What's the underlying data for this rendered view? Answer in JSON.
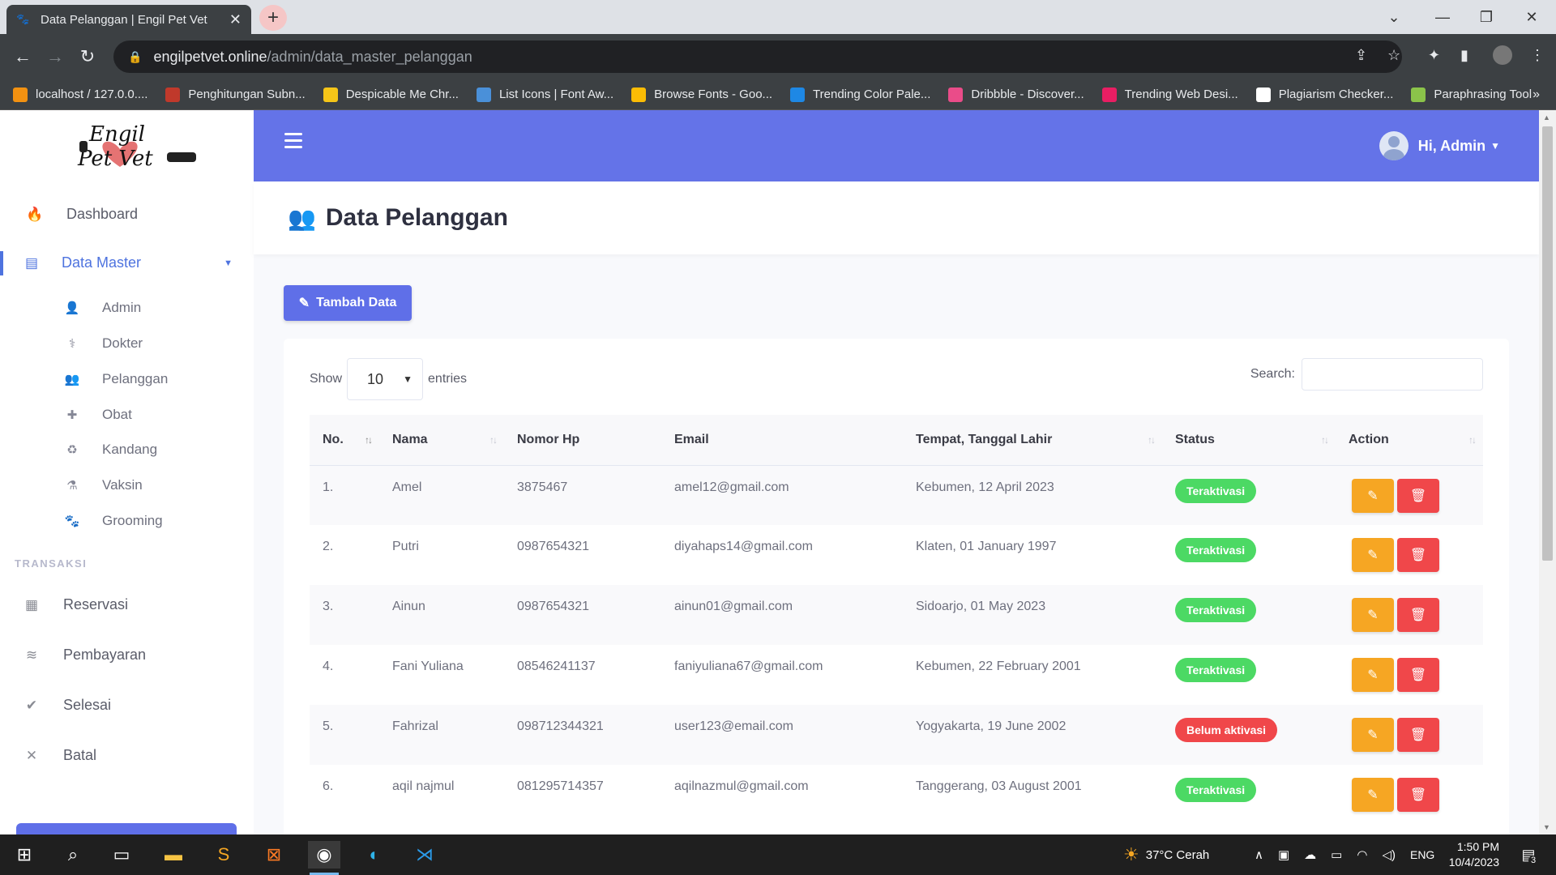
{
  "browser": {
    "tab_title": "Data Pelanggan | Engil Pet Vet",
    "url_host": "engilpetvet.online",
    "url_path": "/admin/data_master_pelanggan",
    "bookmarks": [
      {
        "label": "localhost / 127.0.0....",
        "color": "#f29111"
      },
      {
        "label": "Penghitungan Subn...",
        "color": "#c0392b"
      },
      {
        "label": "Despicable Me Chr...",
        "color": "#f5c518"
      },
      {
        "label": "List Icons | Font Aw...",
        "color": "#4a90d9"
      },
      {
        "label": "Browse Fonts - Goo...",
        "color": "#fbbc05"
      },
      {
        "label": "Trending Color Pale...",
        "color": "#1e88e5"
      },
      {
        "label": "Dribbble - Discover...",
        "color": "#ea4c89"
      },
      {
        "label": "Trending Web Desi...",
        "color": "#e91e63"
      },
      {
        "label": "Plagiarism Checker...",
        "color": "#ffffff"
      },
      {
        "label": "Paraphrasing Tool",
        "color": "#8bc34a"
      }
    ]
  },
  "sidebar": {
    "logo_line1": "Engil",
    "logo_line2": "Pet Vet",
    "dashboard": "Dashboard",
    "data_master": "Data Master",
    "sub_items": [
      {
        "label": "Admin",
        "icon": "user-icon",
        "glyph": "👤"
      },
      {
        "label": "Dokter",
        "icon": "user-md-icon",
        "glyph": "⚕"
      },
      {
        "label": "Pelanggan",
        "icon": "users-icon",
        "glyph": "👥"
      },
      {
        "label": "Obat",
        "icon": "first-aid-icon",
        "glyph": "✚"
      },
      {
        "label": "Kandang",
        "icon": "recycle-icon",
        "glyph": "♻"
      },
      {
        "label": "Vaksin",
        "icon": "flask-icon",
        "glyph": "⚗"
      },
      {
        "label": "Grooming",
        "icon": "paw-icon",
        "glyph": "🐾"
      }
    ],
    "section_transaksi": "TRANSAKSI",
    "transaksi_items": [
      {
        "label": "Reservasi",
        "icon": "th-large-icon",
        "glyph": "▦"
      },
      {
        "label": "Pembayaran",
        "icon": "database-icon",
        "glyph": "≋"
      },
      {
        "label": "Selesai",
        "icon": "check-icon",
        "glyph": "✔"
      },
      {
        "label": "Batal",
        "icon": "times-icon",
        "glyph": "✕"
      }
    ]
  },
  "topbar": {
    "user_greeting": "Hi, Admin"
  },
  "page": {
    "title": "Data Pelanggan",
    "add_button": "Tambah Data",
    "show_label": "Show",
    "entries_value": "10",
    "entries_label": "entries",
    "search_label": "Search:",
    "search_value": ""
  },
  "table": {
    "headers": [
      "No.",
      "Nama",
      "Nomor Hp",
      "Email",
      "Tempat, Tanggal Lahir",
      "Status",
      "Action"
    ],
    "rows": [
      {
        "no": "1.",
        "nama": "Amel",
        "hp": "3875467",
        "email": "amel12@gmail.com",
        "ttl": "Kebumen, 12 April 2023",
        "status": "Teraktivasi"
      },
      {
        "no": "2.",
        "nama": "Putri",
        "hp": "0987654321",
        "email": "diyahaps14@gmail.com",
        "ttl": "Klaten, 01 January 1997",
        "status": "Teraktivasi"
      },
      {
        "no": "3.",
        "nama": "Ainun",
        "hp": "0987654321",
        "email": "ainun01@gmail.com",
        "ttl": "Sidoarjo, 01 May 2023",
        "status": "Teraktivasi"
      },
      {
        "no": "4.",
        "nama": "Fani Yuliana",
        "hp": "08546241137",
        "email": "faniyuliana67@gmail.com",
        "ttl": "Kebumen, 22 February 2001",
        "status": "Teraktivasi"
      },
      {
        "no": "5.",
        "nama": "Fahrizal",
        "hp": "098712344321",
        "email": "user123@email.com",
        "ttl": "Yogyakarta, 19 June 2002",
        "status": "Belum aktivasi"
      },
      {
        "no": "6.",
        "nama": "aqil najmul",
        "hp": "081295714357",
        "email": "aqilnazmul@gmail.com",
        "ttl": "Tanggerang, 03 August 2001",
        "status": "Teraktivasi"
      }
    ]
  },
  "colors": {
    "primary": "#5f6fe8",
    "topbar": "#6473e8",
    "status_active": "#4cd964",
    "status_inactive": "#f0474a",
    "edit": "#f6a623",
    "delete": "#f0474a"
  },
  "taskbar": {
    "weather": "37°C  Cerah",
    "lang": "ENG",
    "time": "1:50 PM",
    "date": "10/4/2023",
    "notifications": "3"
  }
}
